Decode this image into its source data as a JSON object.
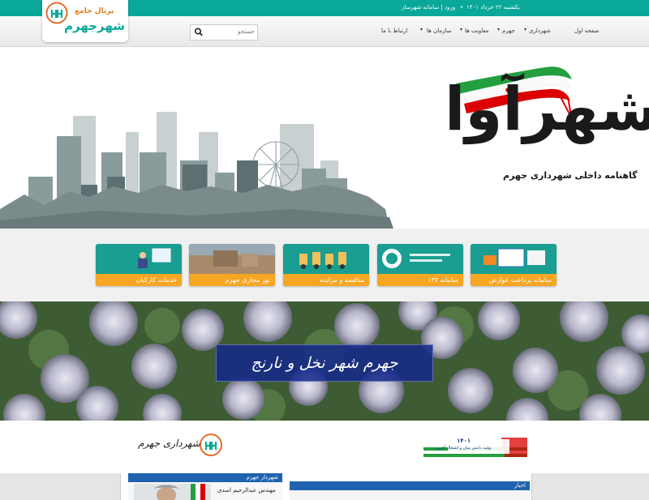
{
  "topbar": {
    "login_link": "ورود | سامانه شهرساز",
    "date": "یکشنبه ۲۲ خرداد ۱۴۰۱"
  },
  "logo": {
    "line1": "پرتال جامع",
    "line2": "شهرجهرم"
  },
  "nav": {
    "items": [
      "صفحه اول",
      "شهرداری",
      "جهرم",
      "معاونت ها",
      "سازمان ها",
      "ارتباط با ما"
    ],
    "search_placeholder": "جستجو"
  },
  "hero": {
    "title": "شهرآوا",
    "subtitle": "گاهنامه داخلی شهرداری جهرم"
  },
  "services": [
    {
      "label": "سامانه پرداخت عوارض"
    },
    {
      "label": "سامانه ۱۳۷"
    },
    {
      "label": "مناقصه و مزایده"
    },
    {
      "label": "تور مجازی جهرم"
    },
    {
      "label": "خدمات کارکنان"
    }
  ],
  "banner": {
    "slogan": "جهرم شهر نخل و نارنج"
  },
  "logos_row": {
    "year_title": "۱۴۰۱",
    "year_subtitle": "تولید، دانش بنیان و اشتغال آفرین",
    "city_hall_sign": "شهرداری جهرم"
  },
  "bottom": {
    "news_title": "اخبار",
    "mayor_title": "شهردار جهرم",
    "mayor_name": "مهندس عبدالرحیم اسدی"
  },
  "colors": {
    "teal": "#0aa89a",
    "orange": "#f5a623",
    "navy": "#1f63b0",
    "flag_green": "#239f40",
    "flag_red": "#da0000"
  },
  "icons": [
    "search-icon",
    "chevron-down-icon"
  ]
}
